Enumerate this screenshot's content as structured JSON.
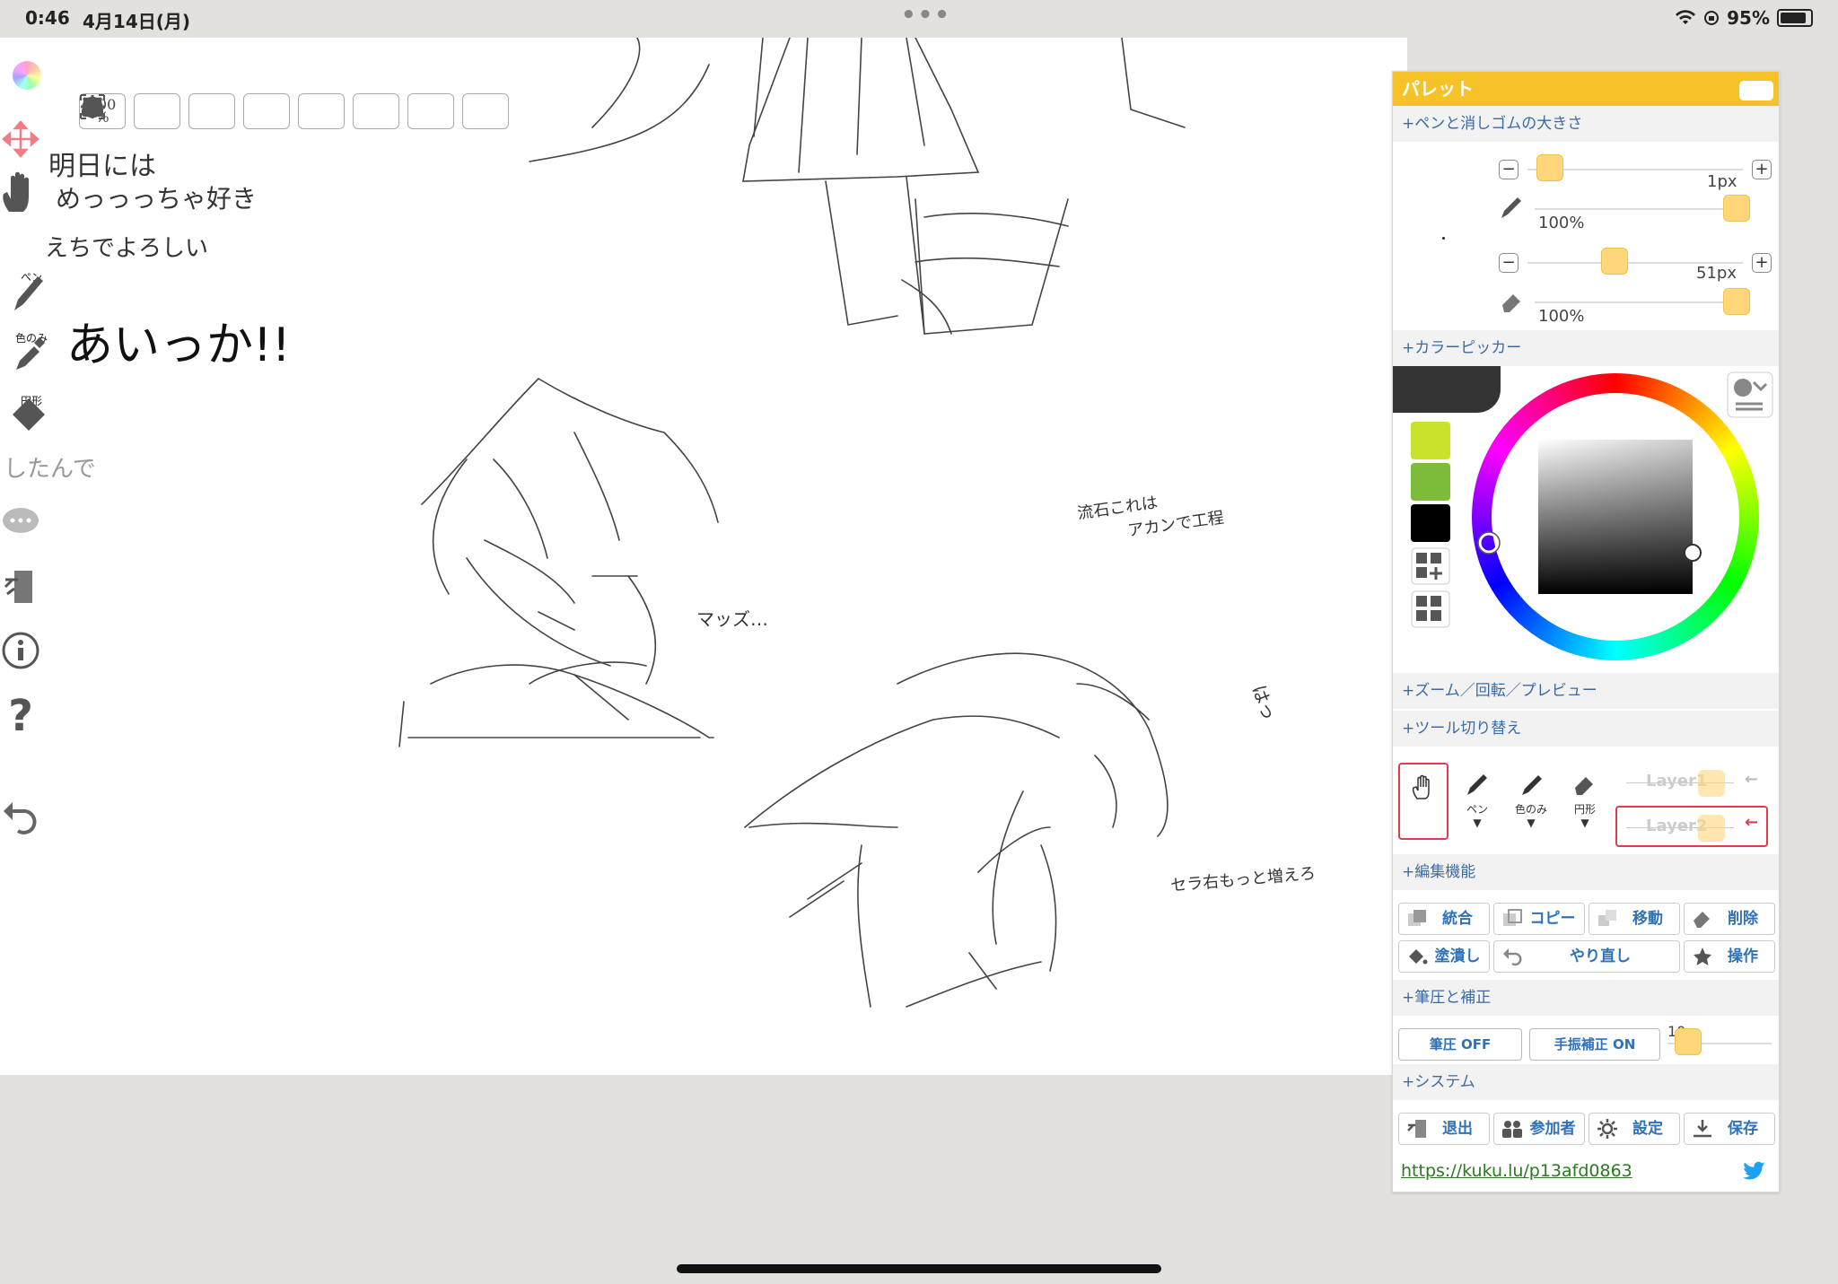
{
  "status_bar": {
    "time": "0:46",
    "date": "4月14日(月)",
    "dots": "•••",
    "battery": "95%"
  },
  "toolbar": {
    "zoom_value": "100",
    "zoom_unit": "%"
  },
  "left_tools": {
    "pen_label": "ペン",
    "eyedropper_label": "色のみ",
    "shape_label": "円形"
  },
  "canvas_text": {
    "line1": "明日には",
    "line2": "めっっっちゃ好き",
    "line3": "えちでよろしい",
    "line4": "あいっか!!",
    "line5": "したんで",
    "note_massu": "マッズ…",
    "note_top": "流石これは",
    "note_top2": "アカンで工程",
    "note_ha": "はっ",
    "note_bottom": "セラ右もっと増えろ"
  },
  "palette": {
    "title": "パレット",
    "sections": {
      "pen_size": "+ペンと消しゴムの大きさ",
      "color_picker": "+カラーピッカー",
      "zoom": "+ズーム／回転／プレビュー",
      "tool_switch": "+ツール切り替え",
      "edit": "+編集機能",
      "pressure": "+筆圧と補正",
      "system": "+システム"
    },
    "pen": {
      "size": "1px",
      "opacity": "100%"
    },
    "eraser": {
      "size": "51px",
      "opacity": "100%"
    },
    "swatches": [
      "#c9e22c",
      "#7dbb3a",
      "#000000"
    ],
    "tools": {
      "pen": "ペン",
      "eyedropper": "色のみ",
      "shape": "円形"
    },
    "layers": [
      "Layer1",
      "Layer2"
    ],
    "edit_buttons": [
      "統合",
      "コピー",
      "移動",
      "削除",
      "塗潰し",
      "やり直し",
      "操作"
    ],
    "pressure": {
      "pressure_btn": "筆圧 OFF",
      "stabilizer_btn": "手振補正 ON",
      "stabilizer_value": "10"
    },
    "system_buttons": [
      "退出",
      "参加者",
      "設定",
      "保存"
    ],
    "share_url": "https://kuku.lu/p13afd0863"
  },
  "colors": {
    "accent": "#f5c228",
    "link": "#2f72b8",
    "layer_active": "#e03c4a"
  }
}
